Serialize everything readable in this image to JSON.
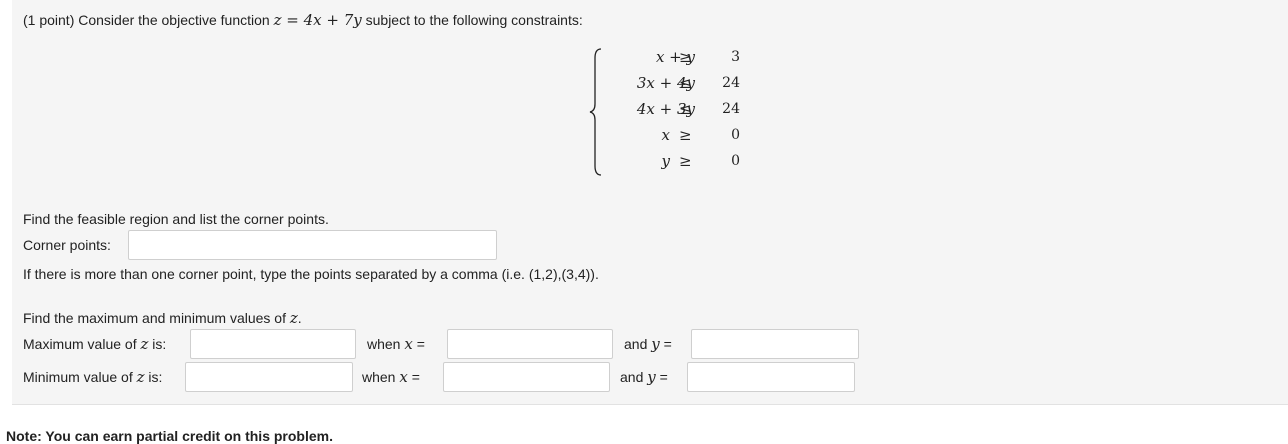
{
  "problem": {
    "intro_prefix": "(1 point) Consider the objective function ",
    "objective": "z = 4x + 7y",
    "intro_suffix": " subject to the following constraints:"
  },
  "constraints": [
    {
      "lhs": "x + y",
      "rel": "≥",
      "rhs": "3"
    },
    {
      "lhs": "3x + 4y",
      "rel": "≤",
      "rhs": "24"
    },
    {
      "lhs": "4x + 3y",
      "rel": "≤",
      "rhs": "24"
    },
    {
      "lhs": "x",
      "rel": "≥",
      "rhs": "0"
    },
    {
      "lhs": "y",
      "rel": "≥",
      "rhs": "0"
    }
  ],
  "feasible": {
    "instruction": "Find the feasible region and list the corner points.",
    "corner_label": "Corner points:",
    "corner_value": "",
    "hint": "If there is more than one corner point, type the points separated by a comma (i.e. (1,2),(3,4))."
  },
  "extrema": {
    "instruction": "Find the maximum and minimum values of z.",
    "max_label": "Maximum value of z is:",
    "min_label": "Minimum value of z is:",
    "when_x": "when x =",
    "and_y": "and y =",
    "max_value": "",
    "max_x": "",
    "max_y": "",
    "min_value": "",
    "min_x": "",
    "min_y": ""
  },
  "footer_note": "Note: You can earn partial credit on this problem."
}
